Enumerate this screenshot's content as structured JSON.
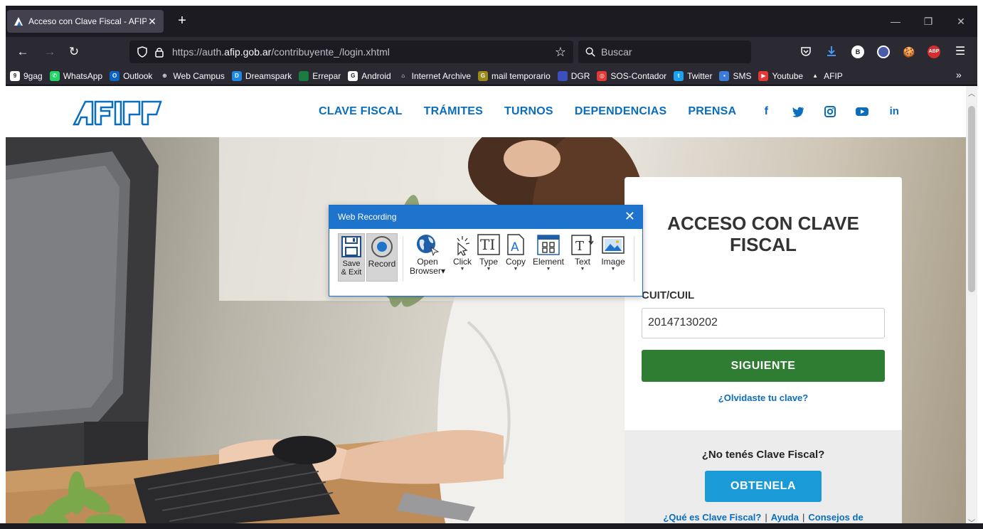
{
  "browser": {
    "tab_title": "Acceso con Clave Fiscal - AFIP",
    "tab_close": "✕",
    "new_tab": "+",
    "url_prefix": "https://auth.",
    "url_domain": "afip.gob.ar",
    "url_path": "/contribuyente_/login.xhtml",
    "search_placeholder": "Buscar",
    "toolbar_icons": [
      "pocket-icon",
      "download-icon",
      "b-extension-icon",
      "block-icon",
      "cookie-icon",
      "adblock-plus-icon",
      "menu-icon"
    ],
    "abp_label": "ABP",
    "b_label": "B"
  },
  "bookmarks": [
    {
      "label": "9gag",
      "icon": "9gag-icon",
      "color": "#ffffff",
      "glyph": "9"
    },
    {
      "label": "WhatsApp",
      "icon": "whatsapp-icon",
      "color": "#25d366",
      "glyph": "✆"
    },
    {
      "label": "Outlook",
      "icon": "outlook-icon",
      "color": "#0a64c8",
      "glyph": "O"
    },
    {
      "label": "Web Campus",
      "icon": "globe-icon",
      "color": "#2b2a33",
      "glyph": "⊕"
    },
    {
      "label": "Dreamspark",
      "icon": "dreamspark-icon",
      "color": "#1e88e5",
      "glyph": "D"
    },
    {
      "label": "Errepar",
      "icon": "errepar-icon",
      "color": "#1b7a3d",
      "glyph": ""
    },
    {
      "label": "Android",
      "icon": "google-icon",
      "color": "#ffffff",
      "glyph": "G"
    },
    {
      "label": "Internet Archive",
      "icon": "archive-icon",
      "color": "#2b2a33",
      "glyph": "⌂"
    },
    {
      "label": "mail temporario",
      "icon": "mail-temp-icon",
      "color": "#9a8a1c",
      "glyph": "G"
    },
    {
      "label": "DGR",
      "icon": "dgr-icon",
      "color": "#3b4fbf",
      "glyph": ""
    },
    {
      "label": "SOS-Contador",
      "icon": "lifebuoy-icon",
      "color": "#e53935",
      "glyph": "◎"
    },
    {
      "label": "Twitter",
      "icon": "twitter-icon",
      "color": "#1da1f2",
      "glyph": "t"
    },
    {
      "label": "SMS",
      "icon": "sms-icon",
      "color": "#3d7bd8",
      "glyph": "▪"
    },
    {
      "label": "Youtube",
      "icon": "youtube-icon",
      "color": "#e53935",
      "glyph": "▶"
    },
    {
      "label": "AFIP",
      "icon": "afip-icon",
      "color": "#2b2a33",
      "glyph": "▲"
    }
  ],
  "site": {
    "nav": [
      "CLAVE FISCAL",
      "TRÁMITES",
      "TURNOS",
      "DEPENDENCIAS",
      "PRENSA"
    ],
    "social": [
      {
        "name": "facebook-icon",
        "glyph": "f"
      },
      {
        "name": "twitter-icon",
        "glyph": "🐦"
      },
      {
        "name": "instagram-icon",
        "glyph": "◙"
      },
      {
        "name": "youtube-icon",
        "glyph": "▶"
      },
      {
        "name": "linkedin-icon",
        "glyph": "in"
      }
    ]
  },
  "login": {
    "title": "ACCESO CON CLAVE FISCAL",
    "cuit_label": "CUIT/CUIL",
    "cuit_value": "20147130202",
    "next_button": "SIGUIENTE",
    "forgot_link": "¿Olvidaste tu clave?",
    "no_clave": "¿No tenés Clave Fiscal?",
    "get_button": "OBTENELA",
    "link_what": "¿Qué es Clave Fiscal?",
    "link_help": "Ayuda",
    "link_tips": "Consejos de",
    "separator": "|"
  },
  "recorder": {
    "title": "Web Recording",
    "tools": {
      "save_exit": "Save\n& Exit",
      "record": "Record",
      "open_browser": "Open\nBrowser",
      "click": "Click",
      "type": "Type",
      "copy": "Copy",
      "element": "Element",
      "text": "Text",
      "image": "Image"
    }
  },
  "colors": {
    "afip_blue": "#0b6dbd",
    "next_green": "#2e7d32",
    "get_blue": "#1a9ad6",
    "recorder_blue": "#1e73cc"
  }
}
